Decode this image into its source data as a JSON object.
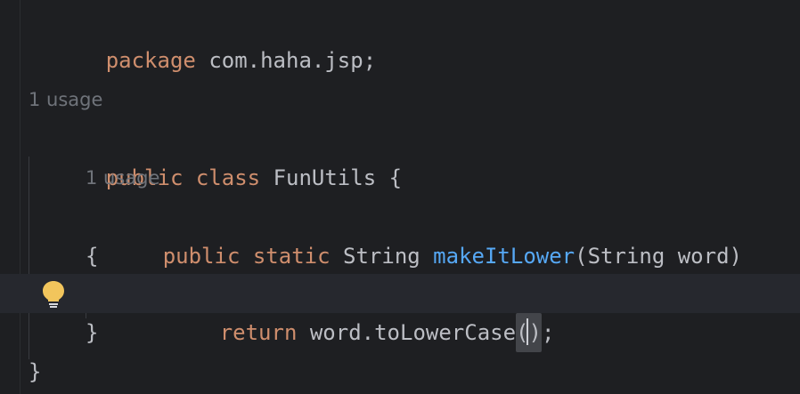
{
  "editor": {
    "line_package": {
      "kw": "package",
      "rest": "com.haha.jsp;"
    },
    "class_usage_hint": "1 usage",
    "line_class": {
      "kw1": "public",
      "kw2": "class",
      "name": "FunUtils",
      "brace": "{"
    },
    "method_usage_hint": "1 usage",
    "line_method": {
      "kw1": "public",
      "kw2": "static",
      "type": "String",
      "name": "makeItLower",
      "params": "(String word)"
    },
    "open_brace": "{",
    "line_return": {
      "kw": "return",
      "expr": "word.toLowerCase",
      "paren_open": "(",
      "paren_close": ")",
      "semi": ";"
    },
    "method_close_brace": "}",
    "class_close_brace": "}"
  },
  "colors": {
    "background": "#1e1f22",
    "keyword": "#cf8e6d",
    "method": "#56a8f5",
    "text": "#bcbec4",
    "hint": "#6f737a",
    "bulb": "#f2c55c"
  },
  "icons": {
    "gutter_action": "lightbulb-icon"
  }
}
